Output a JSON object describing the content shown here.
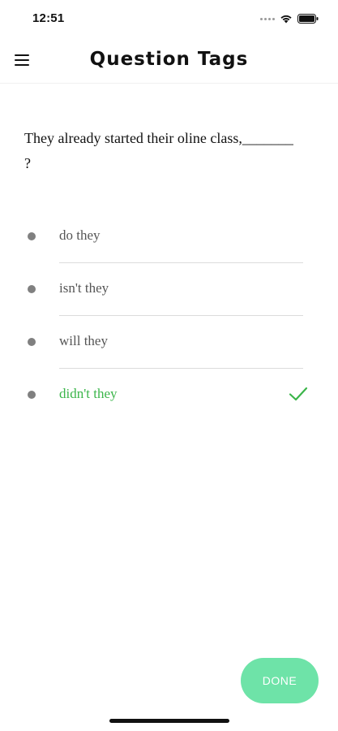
{
  "status_bar": {
    "time": "12:51",
    "icons": [
      "signal-icon",
      "wifi-icon",
      "battery-icon"
    ]
  },
  "header": {
    "menu_icon": "hamburger-menu-icon",
    "title": "Question Tags"
  },
  "question": {
    "text": "They already started their oline class,_______ ?"
  },
  "options": [
    {
      "label": "do they",
      "state": "default"
    },
    {
      "label": "isn't they",
      "state": "default"
    },
    {
      "label": "will they",
      "state": "default"
    },
    {
      "label": "didn't they",
      "state": "correct"
    }
  ],
  "colors": {
    "correct": "#3bb54a",
    "done_button": "#6ee3a8",
    "bullet": "#808080"
  },
  "done_button": {
    "label": "DONE"
  }
}
